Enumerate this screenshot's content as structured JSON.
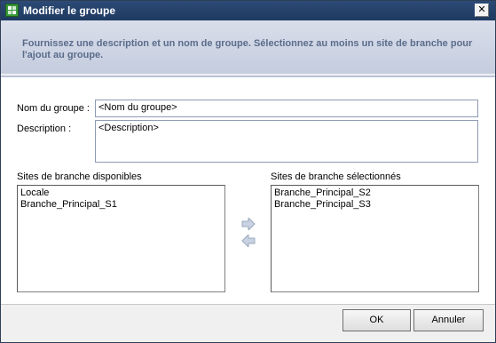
{
  "window": {
    "title": "Modifier le groupe",
    "close_glyph": "✕"
  },
  "banner": {
    "instruction": "Fournissez une description et un nom de groupe. Sélectionnez au moins un site de branche pour l'ajout au groupe."
  },
  "form": {
    "name_label": "Nom du groupe :",
    "name_value": "<Nom du groupe>",
    "description_label": "Description :",
    "description_value": "<Description>"
  },
  "available_sites": {
    "label": "Sites de branche disponibles",
    "items": [
      "Locale",
      "Branche_Principal_S1"
    ]
  },
  "selected_sites": {
    "label": "Sites de branche sélectionnés",
    "items": [
      "Branche_Principal_S2",
      "Branche_Principal_S3"
    ]
  },
  "transfer": {
    "add_icon": "arrow-right-icon",
    "remove_icon": "arrow-left-icon",
    "color": "#b8c3d6"
  },
  "buttons": {
    "ok_label": "OK",
    "cancel_label": "Annuler"
  }
}
